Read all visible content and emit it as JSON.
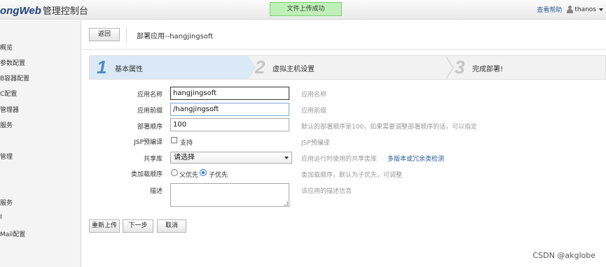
{
  "header": {
    "brand": "ongWeb",
    "title": "管理控制台",
    "toast": "文件上传成功",
    "help": "查看帮助",
    "username": "thanos"
  },
  "sidebar": {
    "items": [
      "概览",
      "参数配置",
      "B容器配置",
      "C配置",
      "管理器",
      "服务",
      "管理",
      "服务",
      "I",
      "Mail配置"
    ]
  },
  "page": {
    "back_label": "返回",
    "breadcrumb": "部署应用--hangjingsoft"
  },
  "wizard": {
    "steps": [
      {
        "num": "1",
        "label": "基本属性"
      },
      {
        "num": "2",
        "label": "虚拟主机设置"
      },
      {
        "num": "3",
        "label": "完成部署!"
      }
    ]
  },
  "form": {
    "app_name": {
      "label": "应用名称",
      "value": "hangjingsoft",
      "hint": "应用名称"
    },
    "app_prefix": {
      "label": "应用前缀",
      "value": "/hangjingsoft",
      "hint": "应用前缀"
    },
    "deploy_order": {
      "label": "部署顺序",
      "value": "100",
      "hint": "默认的部署顺序是100，如果需要调整部署顺序的话，可以指定"
    },
    "jsp_precompile": {
      "label": "JSP预编译",
      "option": "支持",
      "checked": false,
      "hint": "JSP预编译"
    },
    "shared_lib": {
      "label": "共享库",
      "value": "请选择",
      "hint": "应用运行时使用的共享类库",
      "link": "多版本或冗余类检测"
    },
    "classload_order": {
      "label": "类加载顺序",
      "options": [
        "父优先",
        "子优先"
      ],
      "selected": "子优先",
      "hint": "类加载顺序，默认为子优先，可调整"
    },
    "description": {
      "label": "描述",
      "value": "",
      "hint": "该应用的描述信息"
    }
  },
  "actions": {
    "reupload": "重新上传",
    "next": "下一步",
    "cancel": "取消"
  },
  "watermark": "CSDN @akglobe"
}
